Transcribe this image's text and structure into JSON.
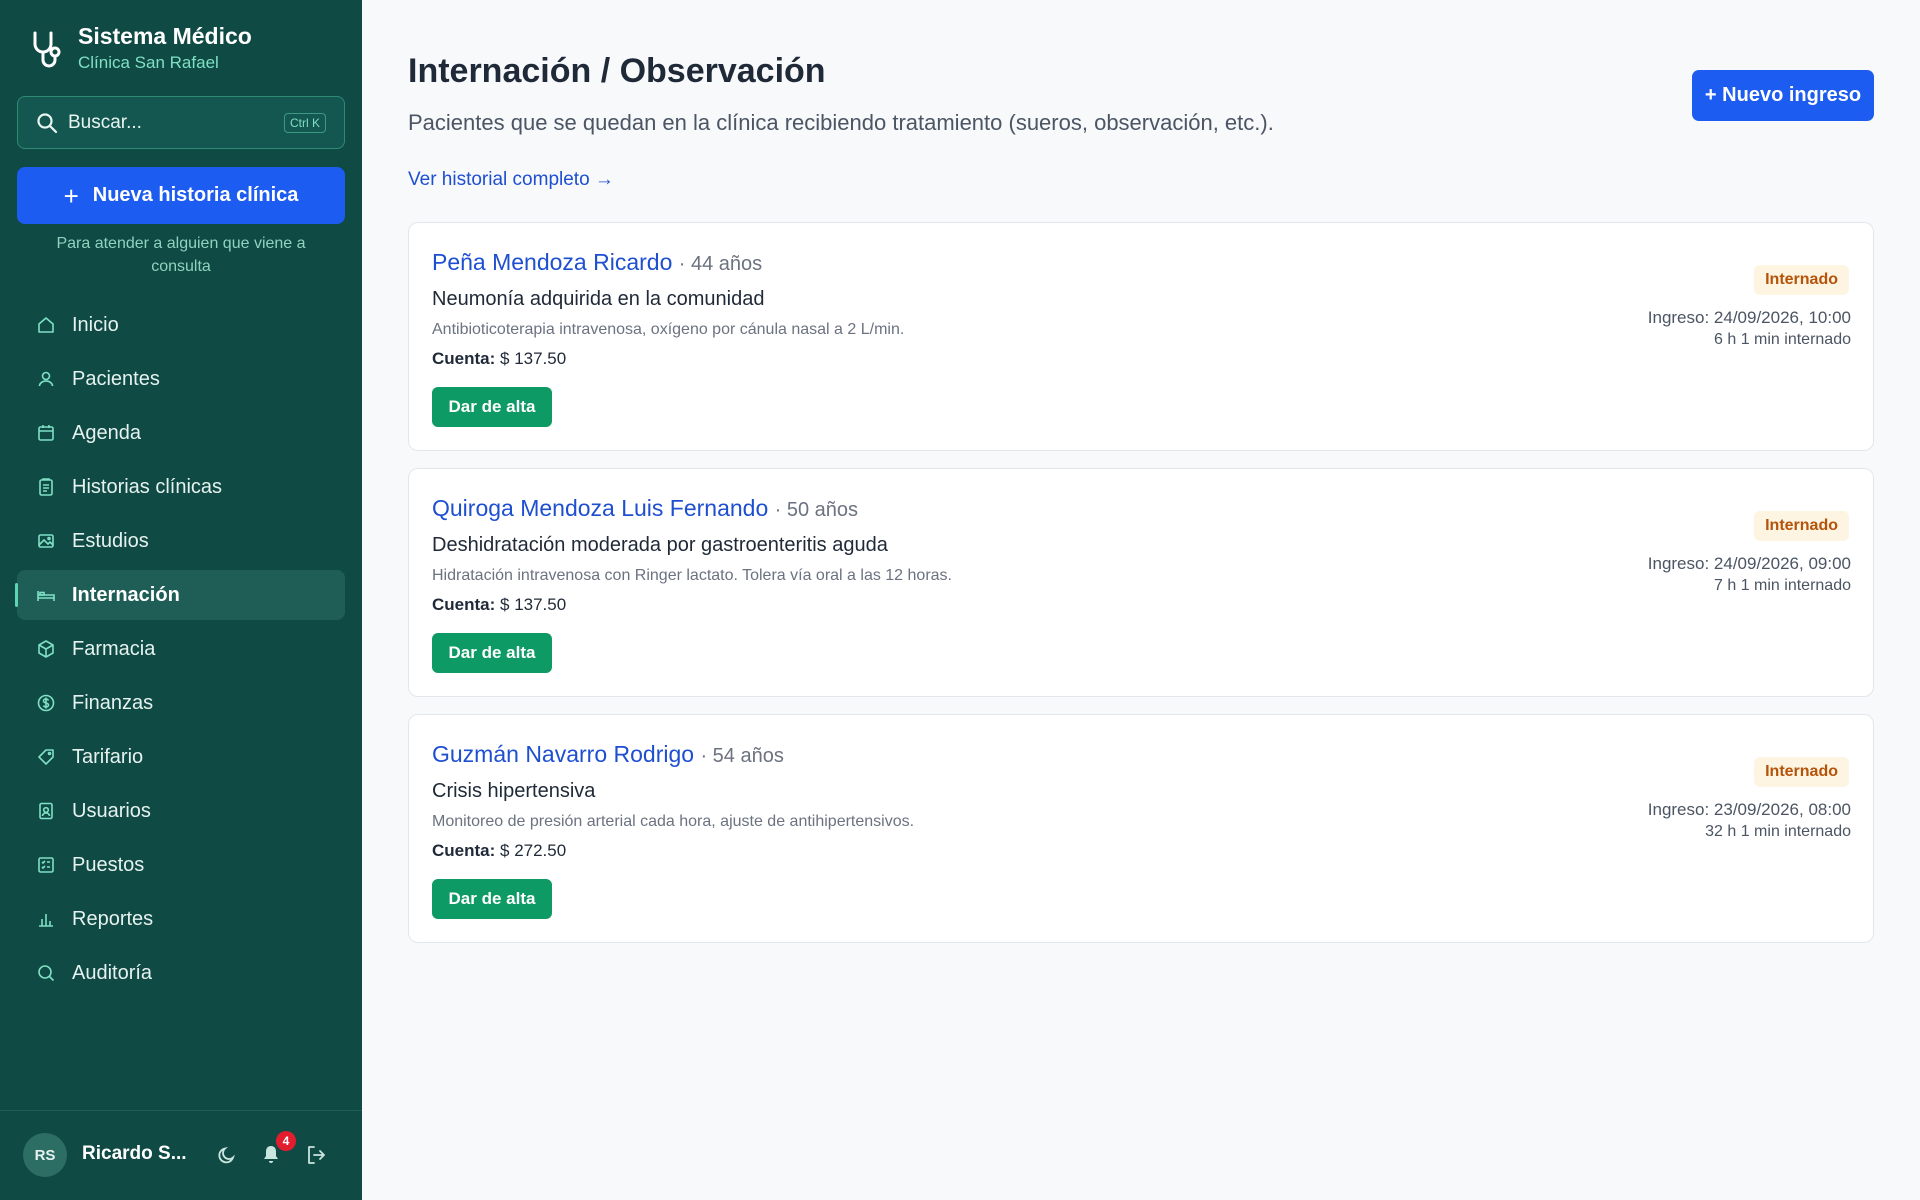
{
  "app": {
    "title": "Sistema Médico",
    "clinic": "Clínica San Rafael"
  },
  "search": {
    "placeholder": "Buscar...",
    "shortcut": "Ctrl K"
  },
  "new_history": {
    "label": "Nueva historia clínica",
    "hint": "Para atender a alguien que viene a consulta"
  },
  "nav": {
    "items": [
      {
        "label": "Inicio",
        "icon": "home-icon"
      },
      {
        "label": "Pacientes",
        "icon": "user-icon"
      },
      {
        "label": "Agenda",
        "icon": "calendar-icon"
      },
      {
        "label": "Historias clínicas",
        "icon": "clipboard-icon"
      },
      {
        "label": "Estudios",
        "icon": "image-icon"
      },
      {
        "label": "Internación",
        "icon": "bed-icon",
        "active": true
      },
      {
        "label": "Farmacia",
        "icon": "box-icon"
      },
      {
        "label": "Finanzas",
        "icon": "dollar-icon"
      },
      {
        "label": "Tarifario",
        "icon": "tag-icon"
      },
      {
        "label": "Usuarios",
        "icon": "id-badge-icon"
      },
      {
        "label": "Puestos",
        "icon": "checklist-icon"
      },
      {
        "label": "Reportes",
        "icon": "bar-chart-icon"
      },
      {
        "label": "Auditoría",
        "icon": "search-icon"
      }
    ]
  },
  "user": {
    "initials": "RS",
    "name": "Ricardo S...",
    "notifications": "4"
  },
  "header": {
    "title": "Internación / Observación",
    "subtitle": "Pacientes que se quedan en la clínica recibiendo tratamiento (sueros, observación, etc.).",
    "history_link": "Ver historial completo →",
    "new_button": "+ Nuevo ingreso"
  },
  "patients": [
    {
      "name": "Peña Mendoza Ricardo",
      "age": "· 44 años",
      "diagnosis": "Neumonía adquirida en la comunidad",
      "treatment": "Antibioticoterapia intravenosa, oxígeno por cánula nasal a 2 L/min.",
      "account_label": "Cuenta:",
      "account_value": "$ 137.50",
      "discharge_label": "Dar de alta",
      "status": "Internado",
      "admission": "Ingreso: 24/09/2026, 10:00",
      "elapsed": "6 h 1 min internado"
    },
    {
      "name": "Quiroga Mendoza Luis Fernando",
      "age": "· 50 años",
      "diagnosis": "Deshidratación moderada por gastroenteritis aguda",
      "treatment": "Hidratación intravenosa con Ringer lactato. Tolera vía oral a las 12 horas.",
      "account_label": "Cuenta:",
      "account_value": "$ 137.50",
      "discharge_label": "Dar de alta",
      "status": "Internado",
      "admission": "Ingreso: 24/09/2026, 09:00",
      "elapsed": "7 h 1 min internado"
    },
    {
      "name": "Guzmán Navarro Rodrigo",
      "age": "· 54 años",
      "diagnosis": "Crisis hipertensiva",
      "treatment": "Monitoreo de presión arterial cada hora, ajuste de antihipertensivos.",
      "account_label": "Cuenta:",
      "account_value": "$ 272.50",
      "discharge_label": "Dar de alta",
      "status": "Internado",
      "admission": "Ingreso: 23/09/2026, 08:00",
      "elapsed": "32 h 1 min internado"
    }
  ],
  "colors": {
    "sidebar_bg": "#0f4a44",
    "primary": "#1d5cf0",
    "success": "#0e9a64",
    "link": "#1e4fd1",
    "status_bg": "#fdf4e1",
    "status_text": "#b45309"
  }
}
